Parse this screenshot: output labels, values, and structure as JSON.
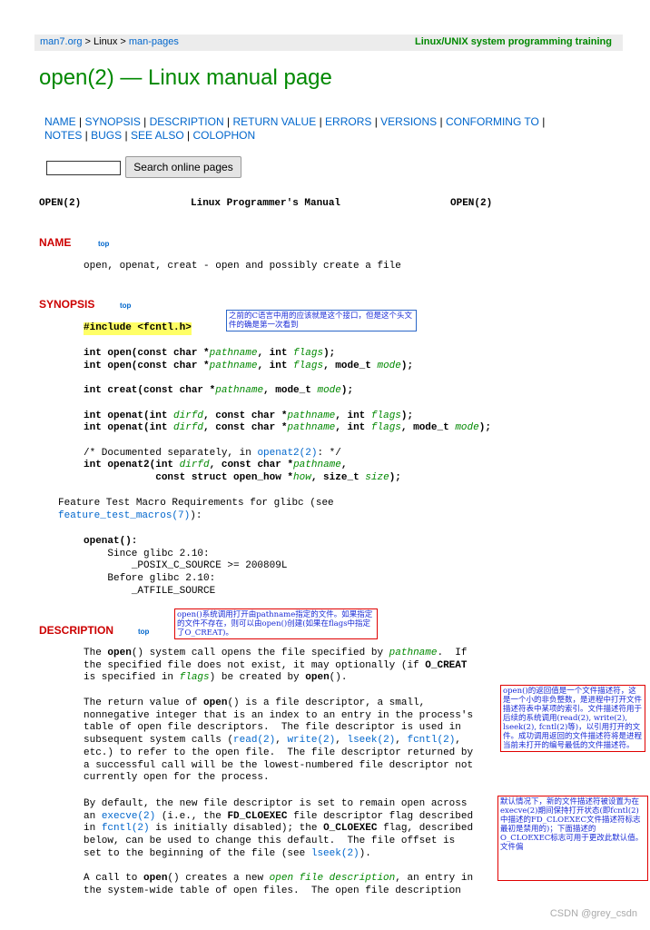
{
  "header": {
    "crumb_home": "man7.org",
    "crumb_sep1": " > ",
    "crumb_linux": "Linux",
    "crumb_sep2": " > ",
    "crumb_manpages": "man-pages",
    "training": "Linux/UNIX system programming training"
  },
  "page_title": "open(2) — Linux manual page",
  "nav": {
    "items": [
      "NAME",
      "SYNOPSIS",
      "DESCRIPTION",
      "RETURN VALUE",
      "ERRORS",
      "VERSIONS",
      "CONFORMING TO",
      "NOTES",
      "BUGS",
      "SEE ALSO",
      "COLOPHON"
    ],
    "separator": " | "
  },
  "search": {
    "value": "",
    "button_label": "Search online pages"
  },
  "manheader": {
    "left": "OPEN(2)",
    "center": "Linux Programmer's Manual",
    "right": "OPEN(2)"
  },
  "sections": {
    "name": {
      "heading": "NAME",
      "top": "top",
      "body": "open, openat, creat - open and possibly create a file"
    },
    "synopsis": {
      "heading": "SYNOPSIS",
      "top": "top",
      "include": "#include <fcntl.h>",
      "ftm_intro": "Feature Test Macro Requirements for glibc (see",
      "ftm_link": "feature_test_macros(7)",
      "ftm_end": "):",
      "openat_label": "openat():",
      "since": "Since glibc 2.10:",
      "posix": "_POSIX_C_SOURCE >= 200809L",
      "before": "Before glibc 2.10:",
      "atfile": "_ATFILE_SOURCE"
    },
    "description": {
      "heading": "DESCRIPTION",
      "top": "top"
    }
  },
  "notes": {
    "include_note": "之前的C语言中用的应该就是这个接口，但是这个头文件的确是第一次看到",
    "desc_note": "open()系统调用打开由pathname指定的文件。如果指定的文件不存在，则可以由open()创建(如果在flags中指定了O_CREAT)。",
    "retval_note": "open()的返回值是一个文件描述符，这是一个小的非负整数，是进程中打开文件描述符表中某项的索引。文件描述符用于后续的系统调用(read(2), write(2), lseek(2), fcntl(2)等)，以引用打开的文件。成功调用返回的文件描述符将是进程当前未打开的编号最低的文件描述符。",
    "cloexec_note": "默认情况下，新的文件描述符被设置为在execve(2)期间保持打开状态(即fcntl(2)中描述的FD_CLOEXEC文件描述符标志最初是禁用的)；下面描述的O_CLOEXEC标志可用于更改此默认值。文件偏"
  },
  "watermark": "CSDN @grey_csdn"
}
